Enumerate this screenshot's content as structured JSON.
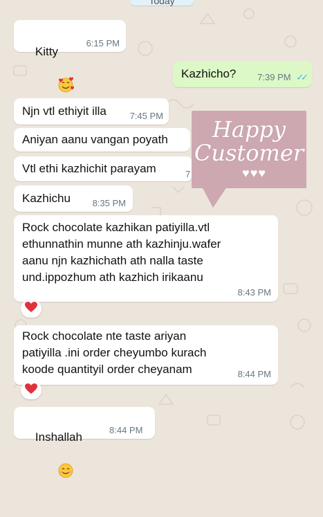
{
  "date_chip": "Today",
  "messages": [
    {
      "text": "Kitty",
      "time": "6:15 PM",
      "emoji": "smiling-face-with-hearts"
    },
    {
      "text": "Kazhicho?",
      "time": "7:39 PM",
      "status": "read"
    },
    {
      "text": "Njn vtl ethiyit illa",
      "time": "7:45 PM"
    },
    {
      "text": "Aniyan aanu vangan poyath"
    },
    {
      "text": "Vtl ethi kazhichit parayam",
      "time": "7"
    },
    {
      "text": "Kazhichu",
      "time": "8:35 PM"
    },
    {
      "text": "Rock chocolate kazhikan patiyilla.vtl\nethunnathin munne ath kazhinju.wafer\naanu njn kazhichath ath nalla taste\nund.ippozhum ath kazhich irikaanu",
      "time": "8:43 PM",
      "reaction": "red-heart"
    },
    {
      "text": "Rock chocolate nte taste ariyan\npatiyilla .ini order cheyumbo kurach\nkoode quantityil order cheyanam",
      "time": "8:44 PM",
      "reaction": "red-heart"
    },
    {
      "text": "Inshallah",
      "time": "8:44 PM",
      "emoji": "smiling-face"
    }
  ],
  "sticker": {
    "line1": "Happy",
    "line2": "Customer",
    "hearts": "♥♥♥",
    "color": "#cda8b1"
  },
  "colors": {
    "incoming": "#ffffff",
    "outgoing": "#dcf8c6",
    "wallpaper": "#ece5dc",
    "read_ticks": "#4fb6ec",
    "heart": "#e0323c"
  }
}
